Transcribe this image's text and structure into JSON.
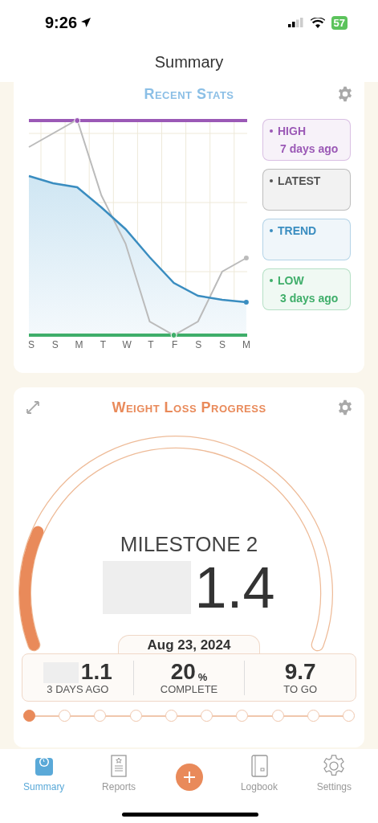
{
  "status_bar": {
    "time": "9:26",
    "battery": "57"
  },
  "nav": {
    "title": "Summary"
  },
  "recent_stats": {
    "title": "Recent Stats",
    "x_labels": [
      "S",
      "S",
      "M",
      "T",
      "W",
      "T",
      "F",
      "S",
      "S",
      "M"
    ],
    "legend": [
      {
        "label": "HIGH",
        "note": "7 days ago",
        "color": "#9b59b6"
      },
      {
        "label": "LATEST",
        "color": "#555555"
      },
      {
        "label": "TREND",
        "color": "#3a8dc0"
      },
      {
        "label": "LOW",
        "note": "3 days ago",
        "color": "#3fae6a"
      }
    ]
  },
  "progress": {
    "title": "Weight Loss Progress",
    "milestone": "MILESTONE 2",
    "value": "1.4",
    "date": "Aug 23, 2024",
    "stats": [
      {
        "value": "1.1",
        "label": "3 DAYS AGO",
        "redacted": true
      },
      {
        "value": "20",
        "unit": "%",
        "label": "COMPLETE",
        "redacted": false
      },
      {
        "value": "9.7",
        "label": "TO GO",
        "redacted": false
      }
    ],
    "milestones": [
      {
        "reached": true
      },
      {
        "reached": false
      },
      {
        "reached": false
      },
      {
        "reached": false
      },
      {
        "reached": false
      },
      {
        "reached": false
      },
      {
        "reached": false
      },
      {
        "reached": false
      },
      {
        "reached": false
      },
      {
        "reached": false
      }
    ]
  },
  "tabs": [
    {
      "label": "Summary",
      "kind": "scale",
      "selected": true
    },
    {
      "label": "Reports",
      "kind": "report",
      "selected": false
    },
    {
      "kind": "add"
    },
    {
      "label": "Logbook",
      "kind": "book",
      "selected": false
    },
    {
      "label": "Settings",
      "kind": "gear",
      "selected": false
    }
  ]
}
